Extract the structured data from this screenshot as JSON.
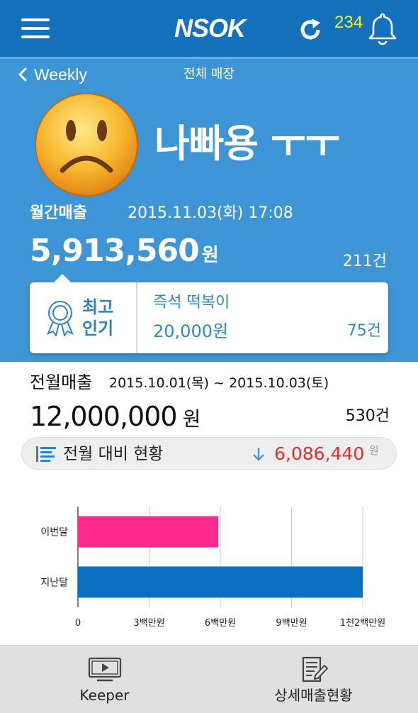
{
  "app": {
    "logo": "NSOK",
    "notification_count": "234",
    "icons": {
      "menu": "menu-icon",
      "refresh": "refresh-icon",
      "bell": "bell-icon"
    },
    "colors": {
      "header": "#1671bd",
      "hero": "#3d95d6",
      "count": "#e8ef31"
    }
  },
  "hero": {
    "back_label": "Weekly",
    "scope_label": "전체 매장",
    "mood_icon": "sad-face-emoji",
    "mood_text": "나빠용 ㅜㅜ",
    "period_label": "월간매출",
    "period_date": "2015.11.03(화) 17:08",
    "amount": "5,913,560",
    "amount_unit": "원",
    "count": "211건"
  },
  "best_item": {
    "icon": "award-ribbon-icon",
    "label_line1": "최고",
    "label_line2": "인기",
    "name": "즉석 떡복이",
    "price": "20,000원",
    "quantity": "75건"
  },
  "previous": {
    "label": "전월매출",
    "range": "2015.10.01(목) ~ 2015.10.03(토)",
    "amount": "12,000,000",
    "unit": "원",
    "count": "530건"
  },
  "comparison": {
    "label": "전월 대비 현황",
    "direction_icon": "arrow-down-icon",
    "diff": "6,086,440",
    "diff_unit": "원",
    "diff_color": "#e0302f"
  },
  "chart_data": {
    "type": "bar",
    "orientation": "horizontal",
    "categories": [
      "이번달",
      "지난달"
    ],
    "values": [
      5913560,
      12000000
    ],
    "colors": [
      "#ff2a8a",
      "#0a6fc2"
    ],
    "xlim": [
      0,
      12000000
    ],
    "ticks": [
      0,
      3000000,
      6000000,
      9000000,
      12000000
    ],
    "tick_labels": [
      "0",
      "3백만원",
      "6백만원",
      "9백만원",
      "1천2백만원"
    ],
    "grid": true,
    "title": "",
    "xlabel": "",
    "ylabel": ""
  },
  "bottom_nav": [
    {
      "label": "Keeper",
      "icon": "monitor-play-icon"
    },
    {
      "label": "상세매출현황",
      "icon": "report-edit-icon"
    }
  ]
}
